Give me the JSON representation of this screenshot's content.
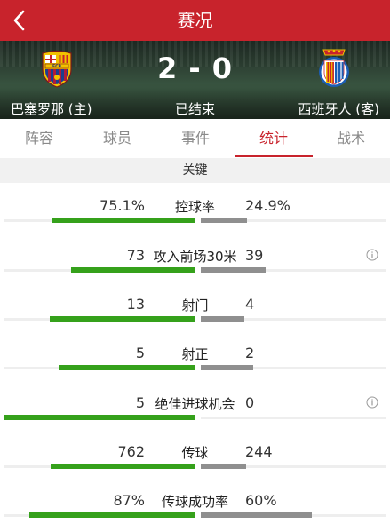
{
  "header": {
    "title": "赛况"
  },
  "match": {
    "home_team": "巴塞罗那 (主)",
    "away_team": "西班牙人 (客)",
    "score": "2 - 0",
    "status": "已结束",
    "home_crest_text": "FCB"
  },
  "tabs": [
    "阵容",
    "球员",
    "事件",
    "统计",
    "战术"
  ],
  "active_tab": "统计",
  "section_title": "关键",
  "colors": {
    "accent": "#c8232c",
    "home_bar": "#35a11b",
    "away_bar": "#8f8f8f"
  },
  "stats": [
    {
      "label": "控球率",
      "home": "75.1%",
      "away": "24.9%",
      "home_frac": 0.751,
      "away_frac": 0.249,
      "info": false
    },
    {
      "label": "攻入前场30米",
      "home": "73",
      "away": "39",
      "home_frac": 0.65,
      "away_frac": 0.35,
      "info": true
    },
    {
      "label": "射门",
      "home": "13",
      "away": "4",
      "home_frac": 0.765,
      "away_frac": 0.235,
      "info": false
    },
    {
      "label": "射正",
      "home": "5",
      "away": "2",
      "home_frac": 0.714,
      "away_frac": 0.286,
      "info": false
    },
    {
      "label": "绝佳进球机会",
      "home": "5",
      "away": "0",
      "home_frac": 1.0,
      "away_frac": 0.0,
      "info": true
    },
    {
      "label": "传球",
      "home": "762",
      "away": "244",
      "home_frac": 0.757,
      "away_frac": 0.243,
      "info": false
    },
    {
      "label": "传球成功率",
      "home": "87%",
      "away": "60%",
      "home_frac": 0.87,
      "away_frac": 0.6,
      "info": false
    }
  ]
}
